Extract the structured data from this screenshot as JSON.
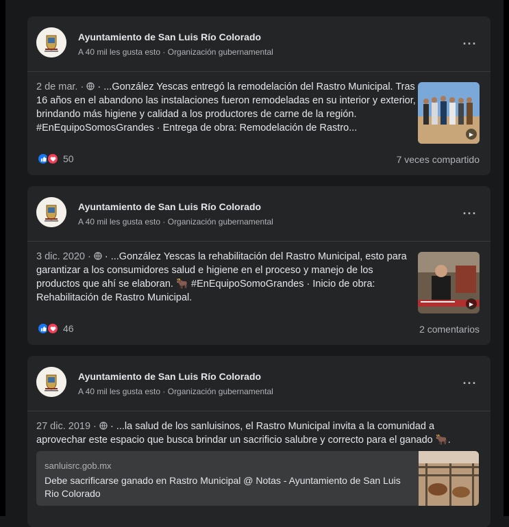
{
  "posts": [
    {
      "page_name": "Ayuntamiento de San Luis Río Colorado",
      "page_meta": "A 40 mil les gusta esto · Organización gubernamental",
      "date": "2 de mar. · ",
      "text": " · ...González Yescas entregó la remodelación del Rastro Municipal. Tras 16 años en el abandono las instalaciones fueron remodeladas en su interior y exterior, brindando más higiene y calidad a los productores de carne de la región. #EnEquipoSomosGrandes · Entrega de obra: Remodelación de Rastro...",
      "reaction_count": "50",
      "engagement": "7 veces compartido"
    },
    {
      "page_name": "Ayuntamiento de San Luis Río Colorado",
      "page_meta": "A 40 mil les gusta esto · Organización gubernamental",
      "date": "3 dic. 2020 · ",
      "text": " · ...González Yescas la rehabilitación del Rastro Municipal, esto para garantizar a los consumidores salud e higiene en el proceso y manejo de los productos que ahí se elaboran. 🐂 #EnEquipoSomoGrandes · Inicio de obra: Rehabilitación de Rastro Municipal.",
      "reaction_count": "46",
      "engagement": "2 comentarios"
    },
    {
      "page_name": "Ayuntamiento de San Luis Río Colorado",
      "page_meta": "A 40 mil les gusta esto · Organización gubernamental",
      "date": "27 dic. 2019 · ",
      "text": " · ...la salud de los sanluisinos, el Rastro Municipal invita a la comunidad a aprovechar este espacio que busca brindar un sacrificio salubre y correcto para el ganado 🐂.",
      "link_domain": "sanluisrc.gob.mx",
      "link_title": "Debe sacrificarse ganado en Rastro Municipal @ Notas - Ayuntamiento de San Luis Rio Colorado"
    }
  ],
  "icons": {
    "more": "more-options-icon",
    "globe": "globe-icon",
    "like": "like-reaction-icon",
    "love": "love-reaction-icon",
    "play": "play-icon"
  },
  "colors": {
    "background": "#18191a",
    "card": "#242526",
    "text": "#e4e6eb",
    "muted": "#b0b3b8",
    "like": "#1877f2",
    "love": "#f33e58"
  }
}
